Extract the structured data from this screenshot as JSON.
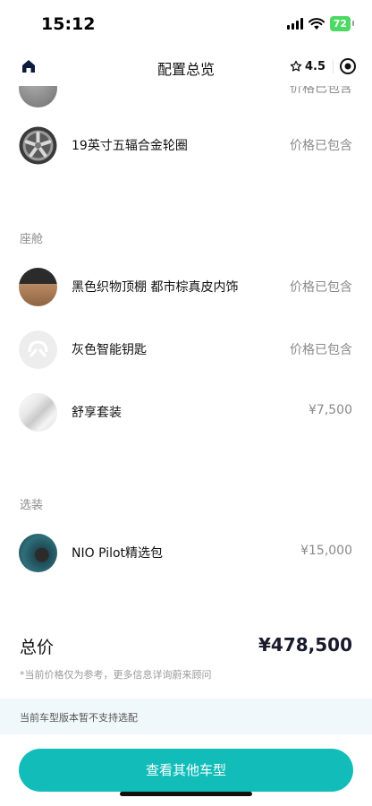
{
  "status_bar": {
    "time": "15:12",
    "battery": "72"
  },
  "header": {
    "title": "配置总览",
    "rating": "4.5"
  },
  "items": [
    {
      "name": "",
      "price": "价格已包含"
    },
    {
      "name": "19英寸五辐合金轮圈",
      "price": "价格已包含"
    },
    {
      "name": "黑色织物顶棚 都市棕真皮内饰",
      "price": "价格已包含"
    },
    {
      "name": "灰色智能钥匙",
      "price": "价格已包含"
    },
    {
      "name": "舒享套装",
      "price": "¥7,500"
    },
    {
      "name": "NIO Pilot精选包",
      "price": "¥15,000"
    }
  ],
  "sections": {
    "cabin": "座舱",
    "options": "选装"
  },
  "total": {
    "label": "总价",
    "value": "¥478,500",
    "disclaimer": "*当前价格仅为参考，更多信息详询蔚来顾问"
  },
  "notice": "当前车型版本暂不支持选配",
  "cta_label": "查看其他车型",
  "colors": {
    "accent": "#12bdb9",
    "notice_bg": "#f1f8fc",
    "battery": "#4cd964"
  }
}
